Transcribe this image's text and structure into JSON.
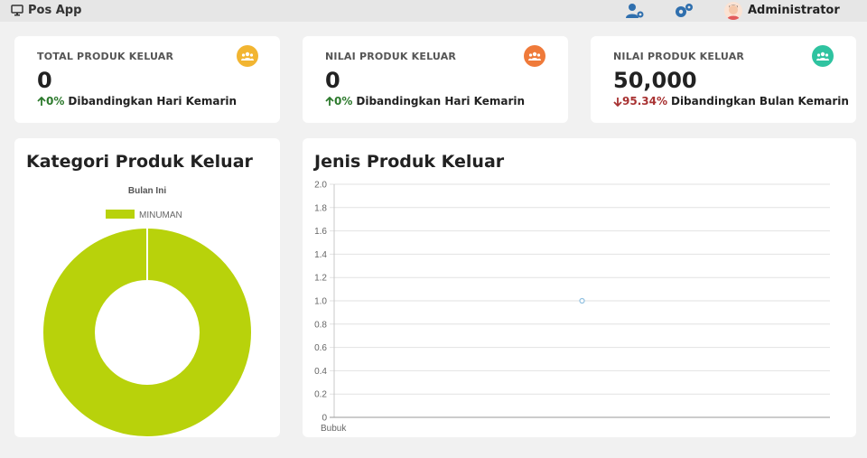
{
  "app": {
    "title": "Pos App",
    "user_name": "Administrator"
  },
  "icons": {
    "brand": "monitor-icon",
    "user_settings": "user-cog-icon",
    "settings": "cogs-icon",
    "stat": "users-icon"
  },
  "colors": {
    "up": "#2d7a2d",
    "down": "#a83232",
    "badge_yellow": "#f2b531",
    "badge_orange": "#ef7a3a",
    "badge_teal": "#2fc3a0",
    "donut": "#b8d20b",
    "line_point": "#90c0e0"
  },
  "stats": [
    {
      "title": "TOTAL PRODUK KELUAR",
      "value": "0",
      "trend": "up",
      "change": "0%",
      "comparison": "Dibandingkan Hari Kemarin"
    },
    {
      "title": "NILAI PRODUK KELUAR",
      "value": "0",
      "trend": "up",
      "change": "0%",
      "comparison": "Dibandingkan Hari Kemarin"
    },
    {
      "title": "NILAI PRODUK KELUAR",
      "value": "50,000",
      "trend": "down",
      "change": "95.34%",
      "comparison": "Dibandingkan Bulan Kemarin"
    }
  ],
  "category_panel": {
    "title": "Kategori Produk Keluar"
  },
  "type_panel": {
    "title": "Jenis Produk Keluar"
  },
  "chart_data": [
    {
      "type": "pie",
      "title": "Bulan Ini",
      "categories": [
        "MINUMAN"
      ],
      "values": [
        1
      ],
      "legend": "top"
    },
    {
      "type": "line",
      "categories": [
        "Bubuk"
      ],
      "series": [
        {
          "values": [
            1
          ]
        }
      ],
      "ylim": [
        0,
        2
      ],
      "yticks": [
        "0",
        "0.2",
        "0.4",
        "0.6",
        "0.8",
        "1.0",
        "1.2",
        "1.4",
        "1.6",
        "1.8",
        "2.0"
      ],
      "grid": true
    }
  ]
}
